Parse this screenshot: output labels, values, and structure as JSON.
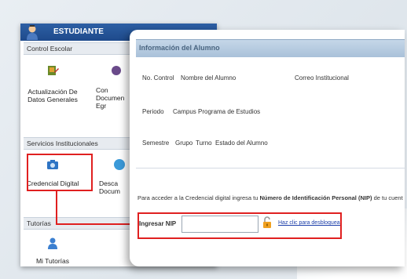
{
  "sidebar": {
    "role_title": "ESTUDIANTE",
    "sections": {
      "control_escolar": "Control Escolar",
      "servicios": "Servicios Institucionales",
      "tutorias": "Tutorías"
    },
    "tiles": {
      "actualizacion": "Actualización De Datos Generales",
      "consulta_partial": "Con Documen Egr",
      "credencial": "Credencial Digital",
      "descarga_partial": "Desca Docum",
      "tutorias": "Mi Tutorías"
    }
  },
  "panel": {
    "header": "Información del Alumno",
    "row1": {
      "no_control": "No. Control",
      "nombre": "Nombre del Alumno",
      "correo": "Correo Institucional"
    },
    "row2": {
      "periodo": "Periodo",
      "campus": "Campus",
      "programa": "Programa de Estudios"
    },
    "row3": {
      "semestre": "Semestre",
      "grupo": "Grupo",
      "turno": "Turno",
      "estado": "Estado del Alumno"
    },
    "instructions": {
      "prefix": "Para acceder a la Credencial digital ingresa tu",
      "bold": "Número de Identificación Personal (NIP)",
      "suffix": "de tu cuent"
    },
    "nip_label": "Ingresar NIP",
    "nip_value": "",
    "unlock_link": "Haz clic para desbloquear"
  },
  "colors": {
    "accent_red": "#e02020",
    "header_blue": "#1e4a8b",
    "link_blue": "#1d3faa"
  }
}
